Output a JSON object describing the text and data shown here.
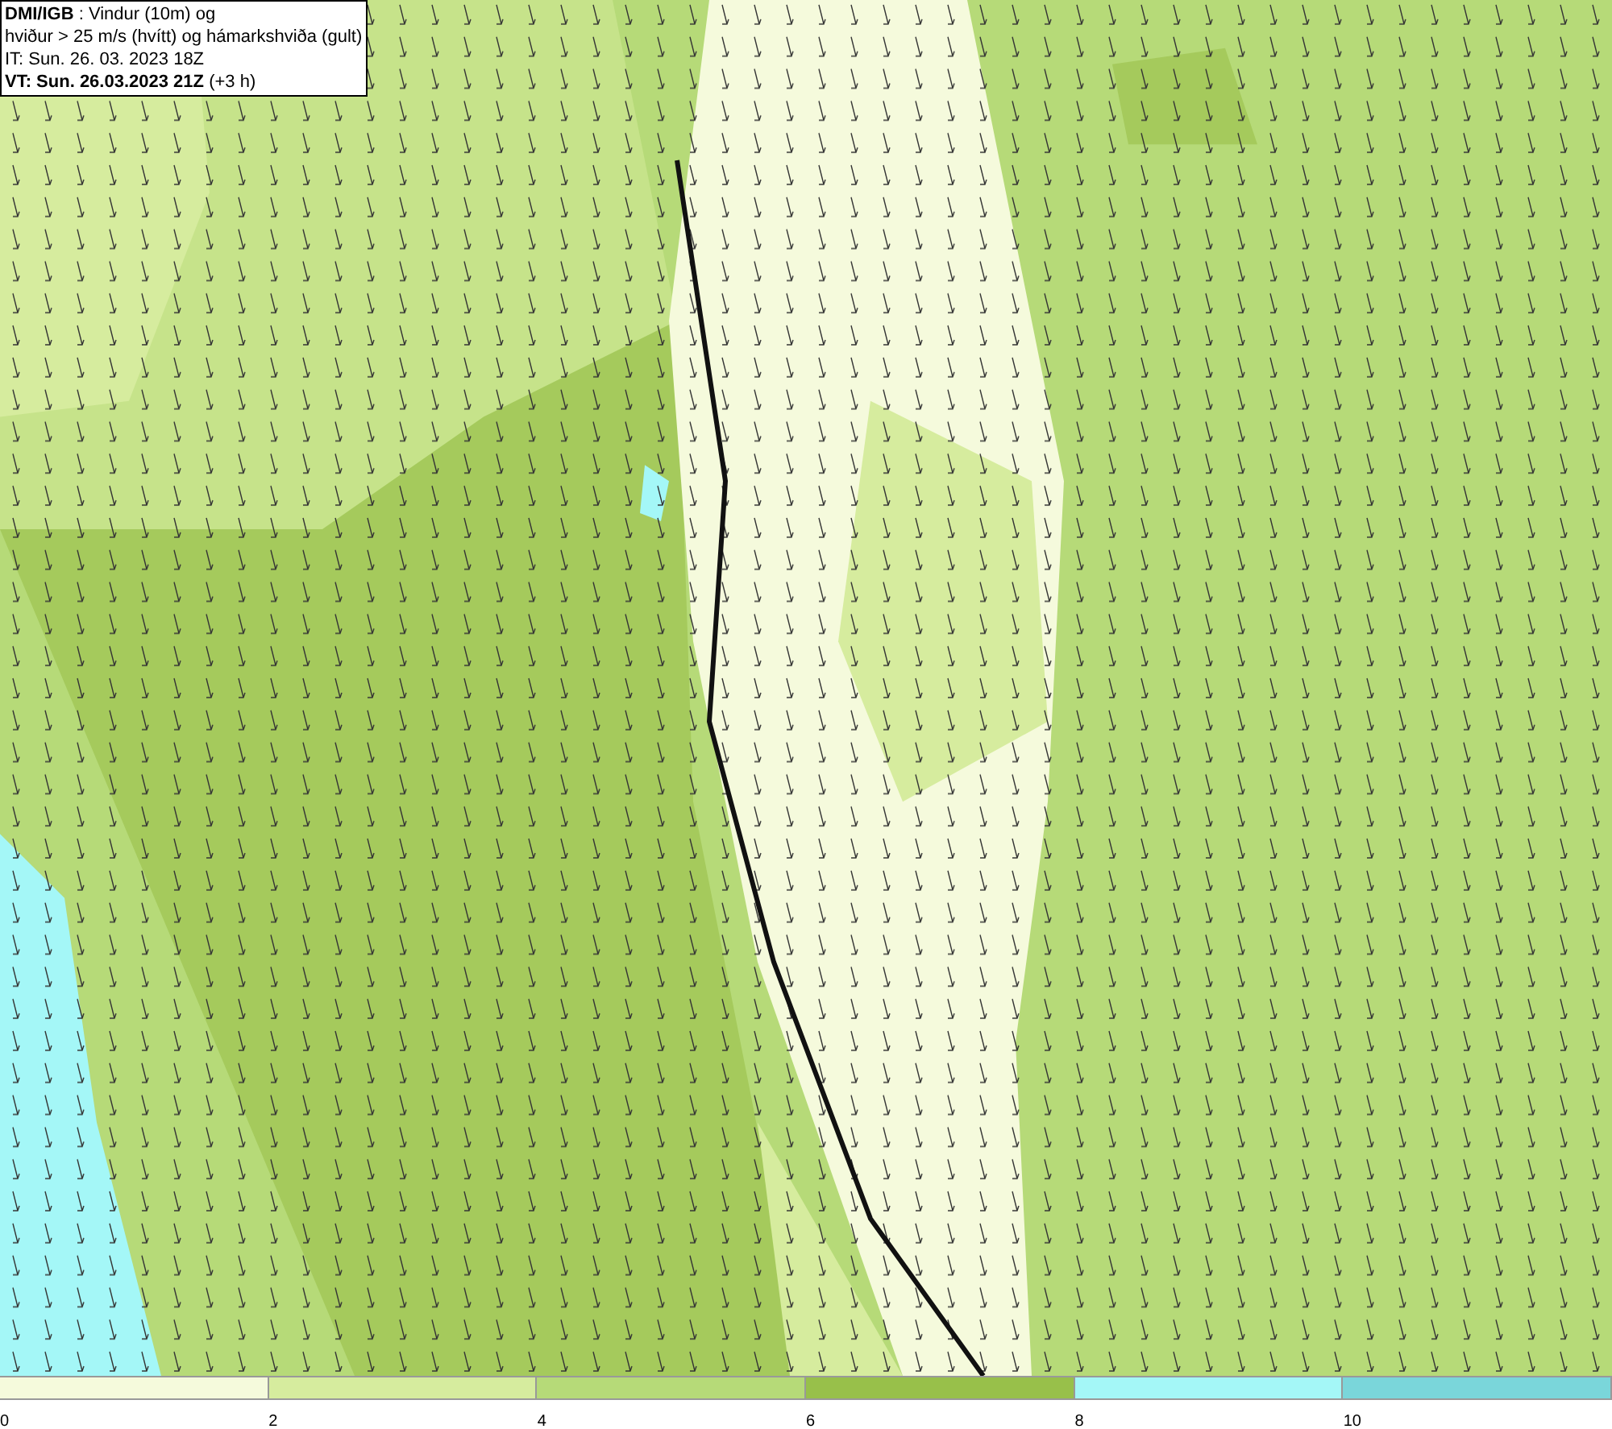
{
  "info_box": {
    "lines": [
      "**DMI/IGB** : Vindur (10m) og",
      "hviður > 25 m/s (hvítt) og hámarkshviða (gult)",
      "IT: Sun. 26. 03. 2023 18Z",
      "**VT: Sun. 26.03.2023 21Z** (+3 h)"
    ]
  },
  "legend": {
    "segments": [
      {
        "label": "0",
        "color": "#f5fadc"
      },
      {
        "label": "2",
        "color": "#d6ec9e"
      },
      {
        "label": "4",
        "color": "#b6da78"
      },
      {
        "label": "6",
        "color": "#98c04a"
      },
      {
        "label": "8",
        "color": "#a4f7f7"
      },
      {
        "label": "10",
        "color": "#7ad6da"
      }
    ]
  }
}
